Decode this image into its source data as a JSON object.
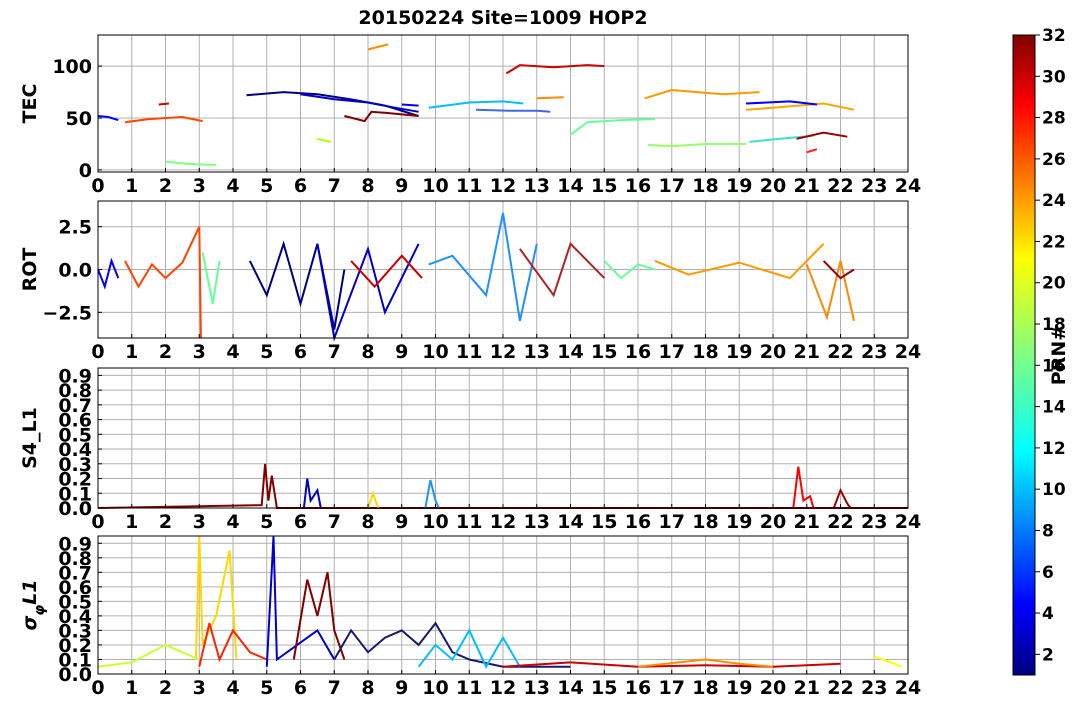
{
  "figure": {
    "title": "20150224 Site=1009 HOP2"
  },
  "colorbar": {
    "label": "PRN#",
    "range": [
      1,
      32
    ],
    "ticks": [
      "2",
      "4",
      "6",
      "8",
      "10",
      "12",
      "14",
      "16",
      "18",
      "20",
      "22",
      "24",
      "26",
      "28",
      "30",
      "32"
    ],
    "colormap": "jet"
  },
  "chart_data": [
    {
      "type": "line",
      "ylabel": "TEC",
      "xlim": [
        0,
        24
      ],
      "ylim": [
        -2,
        130
      ],
      "xticks": [
        "0",
        "1",
        "2",
        "3",
        "4",
        "5",
        "6",
        "7",
        "8",
        "9",
        "10",
        "11",
        "12",
        "13",
        "14",
        "15",
        "16",
        "17",
        "18",
        "19",
        "20",
        "21",
        "22",
        "23",
        "24"
      ],
      "yticks": [
        "0",
        "50",
        "100"
      ],
      "ytick_values": [
        0,
        50,
        100
      ],
      "grid": true,
      "series": [
        {
          "color": "#0000ff",
          "x": [
            0,
            0.3,
            0.6
          ],
          "y": [
            52,
            51,
            48
          ]
        },
        {
          "color": "#ff4500",
          "x": [
            0.8,
            1.5,
            2.5,
            3.1
          ],
          "y": [
            46,
            49,
            51,
            47
          ]
        },
        {
          "color": "#cc0000",
          "x": [
            1.8,
            2.1
          ],
          "y": [
            63,
            64
          ]
        },
        {
          "color": "#80ff80",
          "x": [
            2,
            2.6,
            3.2,
            3.5
          ],
          "y": [
            8,
            6,
            5,
            5
          ]
        },
        {
          "color": "#000080",
          "x": [
            4.4,
            5.5,
            6.5,
            7.5,
            8.5,
            9.5
          ],
          "y": [
            72,
            75,
            73,
            68,
            62,
            52
          ]
        },
        {
          "color": "#0000cd",
          "x": [
            6,
            7,
            8,
            8.8,
            9.5
          ],
          "y": [
            73,
            68,
            65,
            60,
            56
          ]
        },
        {
          "color": "#800000",
          "x": [
            7.3,
            7.9,
            8.1,
            8.5,
            9.5
          ],
          "y": [
            52,
            47,
            56,
            55,
            52
          ]
        },
        {
          "color": "#0000ff",
          "x": [
            9,
            9.5
          ],
          "y": [
            63,
            62
          ]
        },
        {
          "color": "#00bfff",
          "x": [
            9.8,
            11,
            12,
            12.6
          ],
          "y": [
            60,
            65,
            66,
            64
          ]
        },
        {
          "color": "#4169e1",
          "x": [
            11.2,
            12.2,
            13,
            13.4
          ],
          "y": [
            58,
            57,
            57,
            56
          ]
        },
        {
          "color": "#cd0000",
          "x": [
            12.1,
            12.5,
            13.5,
            14.5,
            15
          ],
          "y": [
            93,
            101,
            99,
            101,
            100
          ]
        },
        {
          "color": "#ff8c00",
          "x": [
            13,
            13.8
          ],
          "y": [
            69,
            70
          ]
        },
        {
          "color": "#ff8c00",
          "x": [
            8,
            8.6
          ],
          "y": [
            116,
            121
          ]
        },
        {
          "color": "#66ff99",
          "x": [
            14,
            14.5,
            15.5,
            16.5
          ],
          "y": [
            34,
            46,
            48,
            49
          ]
        },
        {
          "color": "#ff9900",
          "x": [
            16.2,
            17,
            18.5,
            19.6
          ],
          "y": [
            69,
            77,
            73,
            75
          ]
        },
        {
          "color": "#ffa500",
          "x": [
            19.2,
            20,
            21.5,
            22.4
          ],
          "y": [
            58,
            60,
            64,
            58
          ]
        },
        {
          "color": "#0000ff",
          "x": [
            19.2,
            20.5,
            21.3
          ],
          "y": [
            64,
            66,
            63
          ]
        },
        {
          "color": "#99ff66",
          "x": [
            16.3,
            17,
            18,
            19.2
          ],
          "y": [
            24,
            23,
            25,
            25
          ]
        },
        {
          "color": "#40e0d0",
          "x": [
            19.3,
            20.2,
            21.2
          ],
          "y": [
            27,
            30,
            33
          ]
        },
        {
          "color": "#990000",
          "x": [
            20.7,
            21.5,
            22.2
          ],
          "y": [
            30,
            36,
            32
          ]
        },
        {
          "color": "#ff1a1a",
          "x": [
            21,
            21.3
          ],
          "y": [
            17,
            20
          ]
        },
        {
          "color": "#aaff00",
          "x": [
            6.5,
            6.9
          ],
          "y": [
            30,
            27
          ]
        }
      ]
    },
    {
      "type": "line",
      "ylabel": "ROT",
      "xlim": [
        0,
        24
      ],
      "ylim": [
        -4,
        4
      ],
      "xticks": [
        "0",
        "1",
        "2",
        "3",
        "4",
        "5",
        "6",
        "7",
        "8",
        "9",
        "10",
        "11",
        "12",
        "13",
        "14",
        "15",
        "16",
        "17",
        "18",
        "19",
        "20",
        "21",
        "22",
        "23",
        "24"
      ],
      "yticks": [
        "2.5",
        "0.0",
        "−2.5"
      ],
      "ytick_values": [
        2.5,
        0,
        -2.5
      ],
      "grid": true,
      "series": [
        {
          "color": "#0000ff",
          "x": [
            0,
            0.2,
            0.4,
            0.6
          ],
          "y": [
            0,
            -1,
            0.5,
            -0.5
          ]
        },
        {
          "color": "#ff4500",
          "x": [
            0.8,
            1.2,
            1.6,
            2,
            2.5,
            3,
            3.05
          ],
          "y": [
            0.5,
            -1,
            0.3,
            -0.5,
            0.4,
            2.5,
            -4
          ]
        },
        {
          "color": "#66ff99",
          "x": [
            3.1,
            3.4,
            3.6
          ],
          "y": [
            1,
            -2,
            0.5
          ]
        },
        {
          "color": "#000080",
          "x": [
            4.5,
            5,
            5.5,
            6,
            6.5,
            7,
            7.3
          ],
          "y": [
            0.5,
            -1.5,
            1.5,
            -2,
            1.5,
            -3.5,
            0
          ]
        },
        {
          "color": "#0000cd",
          "x": [
            6.5,
            7,
            8,
            8.5,
            9.5
          ],
          "y": [
            1.5,
            -4,
            1.2,
            -2.5,
            1.5
          ]
        },
        {
          "color": "#cc0000",
          "x": [
            7.5,
            8.2,
            9,
            9.6
          ],
          "y": [
            0.5,
            -1,
            0.8,
            -0.5
          ]
        },
        {
          "color": "#1e90ff",
          "x": [
            9.8,
            10.5,
            11.5,
            12,
            12.5,
            13
          ],
          "y": [
            0.3,
            0.8,
            -1.5,
            3.3,
            -3,
            1.5
          ]
        },
        {
          "color": "#b22222",
          "x": [
            12.5,
            13.5,
            14,
            15
          ],
          "y": [
            1.2,
            -1.5,
            1.5,
            -0.5
          ]
        },
        {
          "color": "#66ff99",
          "x": [
            15,
            15.5,
            16,
            16.5
          ],
          "y": [
            0.5,
            -0.5,
            0.3,
            0
          ]
        },
        {
          "color": "#ff9900",
          "x": [
            16.5,
            17.5,
            19,
            20.5,
            21.5
          ],
          "y": [
            0.5,
            -0.3,
            0.4,
            -0.5,
            1.5
          ]
        },
        {
          "color": "#ff8800",
          "x": [
            21,
            21.6,
            22,
            22.4
          ],
          "y": [
            0.3,
            -2.8,
            0.5,
            -3
          ]
        },
        {
          "color": "#990000",
          "x": [
            21.5,
            22,
            22.4
          ],
          "y": [
            0.5,
            -0.5,
            0
          ]
        }
      ]
    },
    {
      "type": "line",
      "ylabel": "S4_L1",
      "xlim": [
        0,
        24
      ],
      "ylim": [
        0,
        0.95
      ],
      "xticks": [
        "0",
        "1",
        "2",
        "3",
        "4",
        "5",
        "6",
        "7",
        "8",
        "9",
        "10",
        "11",
        "12",
        "13",
        "14",
        "15",
        "16",
        "17",
        "18",
        "19",
        "20",
        "21",
        "22",
        "23",
        "24"
      ],
      "yticks": [
        "0.0",
        "0.1",
        "0.2",
        "0.3",
        "0.4",
        "0.5",
        "0.6",
        "0.7",
        "0.8",
        "0.9"
      ],
      "ytick_values": [
        0,
        0.1,
        0.2,
        0.3,
        0.4,
        0.5,
        0.6,
        0.7,
        0.8,
        0.9
      ],
      "grid": true,
      "series": [
        {
          "color": "#800000",
          "x": [
            0,
            4.85,
            4.95,
            5.05,
            5.15,
            5.3,
            24
          ],
          "y": [
            0,
            0.02,
            0.3,
            0.05,
            0.22,
            0,
            0
          ]
        },
        {
          "color": "#0000cd",
          "x": [
            6.1,
            6.2,
            6.3,
            6.5,
            6.6
          ],
          "y": [
            0,
            0.2,
            0.05,
            0.12,
            0
          ]
        },
        {
          "color": "#1e90ff",
          "x": [
            9.7,
            9.85,
            10,
            10.1
          ],
          "y": [
            0,
            0.19,
            0.05,
            0
          ]
        },
        {
          "color": "#ff0000",
          "x": [
            20.6,
            20.75,
            20.9,
            21.1,
            21.2
          ],
          "y": [
            0,
            0.28,
            0.05,
            0.08,
            0
          ]
        },
        {
          "color": "#990000",
          "x": [
            21.8,
            22,
            22.2,
            22.3
          ],
          "y": [
            0,
            0.12,
            0.03,
            0
          ]
        },
        {
          "color": "#ffd700",
          "x": [
            8,
            8.15,
            8.3
          ],
          "y": [
            0,
            0.1,
            0
          ]
        }
      ]
    },
    {
      "type": "line",
      "ylabel": "σφL1",
      "xlim": [
        0,
        24
      ],
      "ylim": [
        0,
        0.95
      ],
      "xticks": [
        "0",
        "1",
        "2",
        "3",
        "4",
        "5",
        "6",
        "7",
        "8",
        "9",
        "10",
        "11",
        "12",
        "13",
        "14",
        "15",
        "16",
        "17",
        "18",
        "19",
        "20",
        "21",
        "22",
        "23",
        "24"
      ],
      "yticks": [
        "0.0",
        "0.1",
        "0.2",
        "0.3",
        "0.4",
        "0.5",
        "0.6",
        "0.7",
        "0.8",
        "0.9"
      ],
      "ytick_values": [
        0,
        0.1,
        0.2,
        0.3,
        0.4,
        0.5,
        0.6,
        0.7,
        0.8,
        0.9
      ],
      "grid": true,
      "series": [
        {
          "color": "#ffd700",
          "x": [
            2.9,
            3,
            3.1,
            3.5,
            3.9,
            4.1
          ],
          "y": [
            0.1,
            0.95,
            0.2,
            0.4,
            0.85,
            0.1
          ]
        },
        {
          "color": "#ff2200",
          "x": [
            3,
            3.3,
            3.6,
            4,
            4.5,
            5
          ],
          "y": [
            0.05,
            0.35,
            0.1,
            0.3,
            0.15,
            0.1
          ]
        },
        {
          "color": "#0000cd",
          "x": [
            5,
            5.2,
            5.3,
            6.5,
            7
          ],
          "y": [
            0.05,
            0.95,
            0.1,
            0.3,
            0.1
          ]
        },
        {
          "color": "#800000",
          "x": [
            5.8,
            6.2,
            6.5,
            6.8,
            7,
            7.3
          ],
          "y": [
            0.1,
            0.65,
            0.4,
            0.7,
            0.3,
            0.1
          ]
        },
        {
          "color": "#191970",
          "x": [
            7,
            7.5,
            8,
            8.5,
            9,
            9.5,
            10,
            10.5,
            11,
            12,
            13,
            14
          ],
          "y": [
            0.1,
            0.3,
            0.15,
            0.25,
            0.3,
            0.2,
            0.35,
            0.15,
            0.1,
            0.05,
            0.05,
            0.05
          ]
        },
        {
          "color": "#00bfff",
          "x": [
            9.5,
            10,
            10.5,
            11,
            11.5,
            12,
            12.5
          ],
          "y": [
            0.05,
            0.2,
            0.1,
            0.3,
            0.05,
            0.25,
            0.05
          ]
        },
        {
          "color": "#cc0000",
          "x": [
            12,
            14,
            16,
            18,
            20,
            22
          ],
          "y": [
            0.05,
            0.08,
            0.05,
            0.06,
            0.05,
            0.07
          ]
        },
        {
          "color": "#ff8c00",
          "x": [
            16,
            18,
            19,
            20
          ],
          "y": [
            0.05,
            0.1,
            0.07,
            0.05
          ]
        },
        {
          "color": "#ccff33",
          "x": [
            0,
            1,
            2,
            3
          ],
          "y": [
            0.05,
            0.08,
            0.2,
            0.1
          ]
        },
        {
          "color": "#ffff00",
          "x": [
            23,
            23.5,
            23.8
          ],
          "y": [
            0.12,
            0.08,
            0.05
          ]
        }
      ]
    }
  ]
}
